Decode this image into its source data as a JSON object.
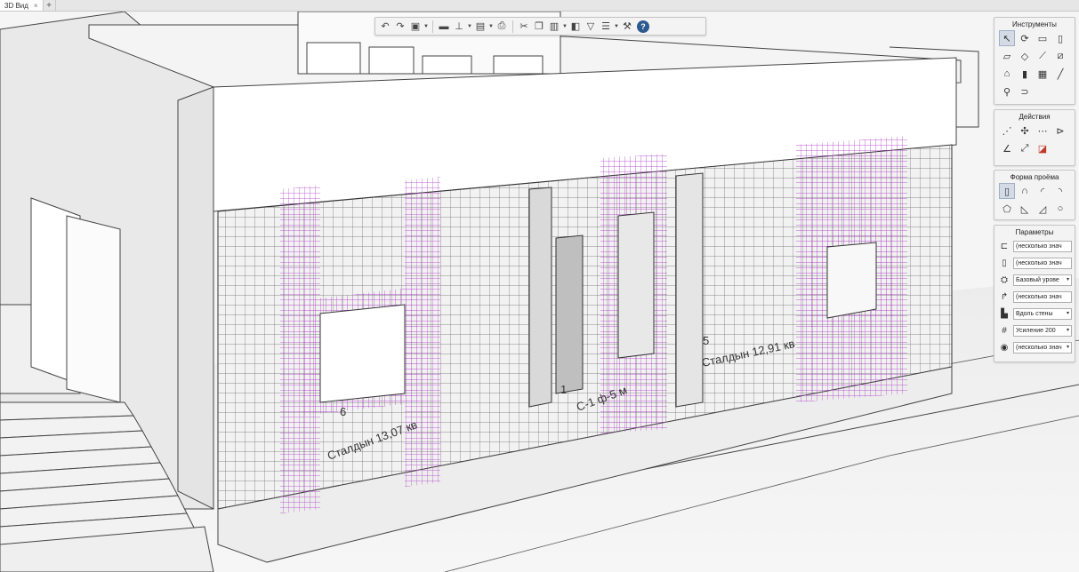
{
  "tabs": [
    {
      "label": "3D Вид",
      "close": "×"
    }
  ],
  "tab_add": "+",
  "toolbar": {
    "icons": [
      "undo-icon",
      "redo-icon",
      "view-icon",
      "layer-icon",
      "plumb-icon",
      "document-icon",
      "print-icon",
      "cut-icon",
      "copy-icon",
      "paste-icon",
      "section-icon",
      "filter-icon",
      "layers-icon",
      "settings-wrench-icon",
      "help-icon"
    ],
    "help_label": "?"
  },
  "panels": {
    "instruments": {
      "title": "Инструменты"
    },
    "actions": {
      "title": "Действия"
    },
    "opening_shape": {
      "title": "Форма проёма"
    },
    "parameters": {
      "title": "Параметры",
      "rows": [
        {
          "icon": "width-icon",
          "value": "(несколько знач"
        },
        {
          "icon": "height-icon",
          "value": "(несколько знач"
        },
        {
          "icon": "level-icon",
          "value": "Базовый урове",
          "dropdown": "▾"
        },
        {
          "icon": "offset-icon",
          "value": "(несколько знач"
        },
        {
          "icon": "placement-icon",
          "value": "Вдоль стены",
          "dropdown": "▾"
        },
        {
          "icon": "reinforcement-icon",
          "value": "Усиление 200",
          "dropdown": "▾"
        },
        {
          "icon": "material-icon",
          "value": "(несколько знач",
          "dropdown": "▾"
        }
      ]
    }
  },
  "scene": {
    "labels": [
      "Сталдын 13,07 кв",
      "Сталдын 12,91 кв",
      "С-1 ф-5 м"
    ],
    "numbers": [
      "6",
      "5",
      "1"
    ]
  },
  "colors": {
    "rebar": "#b040c8",
    "grid": "#3a3a3a",
    "wall": "#ffffff",
    "accent": "#2d5a8e"
  }
}
